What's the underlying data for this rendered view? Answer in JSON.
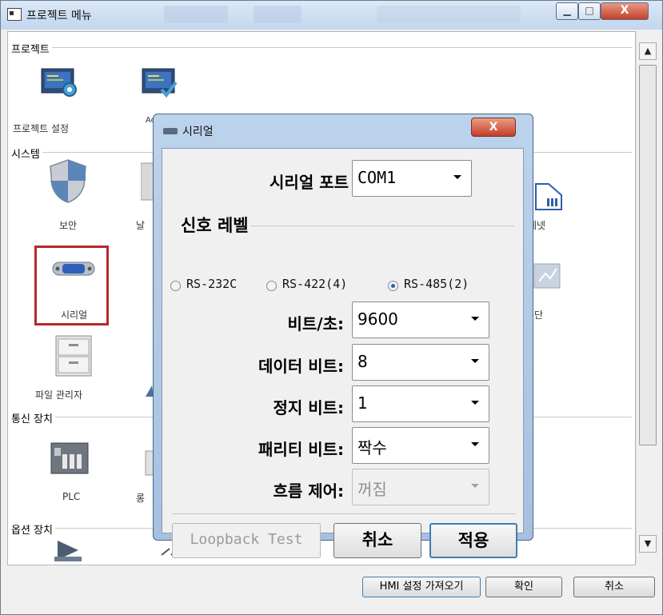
{
  "window": {
    "title": "프로젝트 메뉴",
    "controls": {
      "minimize": "▁",
      "maximize": "□",
      "close": "X"
    }
  },
  "groups": {
    "project": "프로젝트",
    "system": "시스템",
    "comm": "통신 장치",
    "option": "옵션 장치"
  },
  "project_items": [
    {
      "label": "프로젝트 설정",
      "icon": "project-settings-icon"
    },
    {
      "label": "Ac Se",
      "icon": "project-apply-icon"
    }
  ],
  "system_items": [
    {
      "label": "보안",
      "icon": "security-shield-icon"
    },
    {
      "label": "날",
      "icon": "datetime-icon"
    },
    {
      "label": "시리얼",
      "icon": "serial-port-icon"
    },
    {
      "label": "파일 관리자",
      "icon": "file-manager-icon"
    },
    {
      "label": "네넷",
      "icon": "ethernet-icon"
    },
    {
      "label": "단",
      "icon": "diagnostics-icon"
    }
  ],
  "comm_items": [
    {
      "label": "PLC",
      "icon": "plc-icon"
    },
    {
      "label": "롱",
      "icon": "comm-device-icon"
    }
  ],
  "footer": {
    "import_label": "HMI 설정 가져오기",
    "ok_label": "확인",
    "cancel_label": "취소"
  },
  "dialog": {
    "title": "시리얼",
    "close_label": "X",
    "port_label": "시리얼 포트",
    "port_value": "COM1",
    "signal_level_label": "신호 레벨",
    "signal_options": [
      "RS-232C",
      "RS-422(4)",
      "RS-485(2)"
    ],
    "signal_selected": "RS-485(2)",
    "baud_label": "비트/초:",
    "baud_value": "9600",
    "databits_label": "데이터 비트:",
    "databits_value": "8",
    "stopbits_label": "정지 비트:",
    "stopbits_value": "1",
    "parity_label": "패리티 비트:",
    "parity_value": "짝수",
    "flow_label": "흐름 제어:",
    "flow_value": "꺼짐",
    "loopback_label": "Loopback Test",
    "cancel_label": "취소",
    "apply_label": "적용"
  }
}
